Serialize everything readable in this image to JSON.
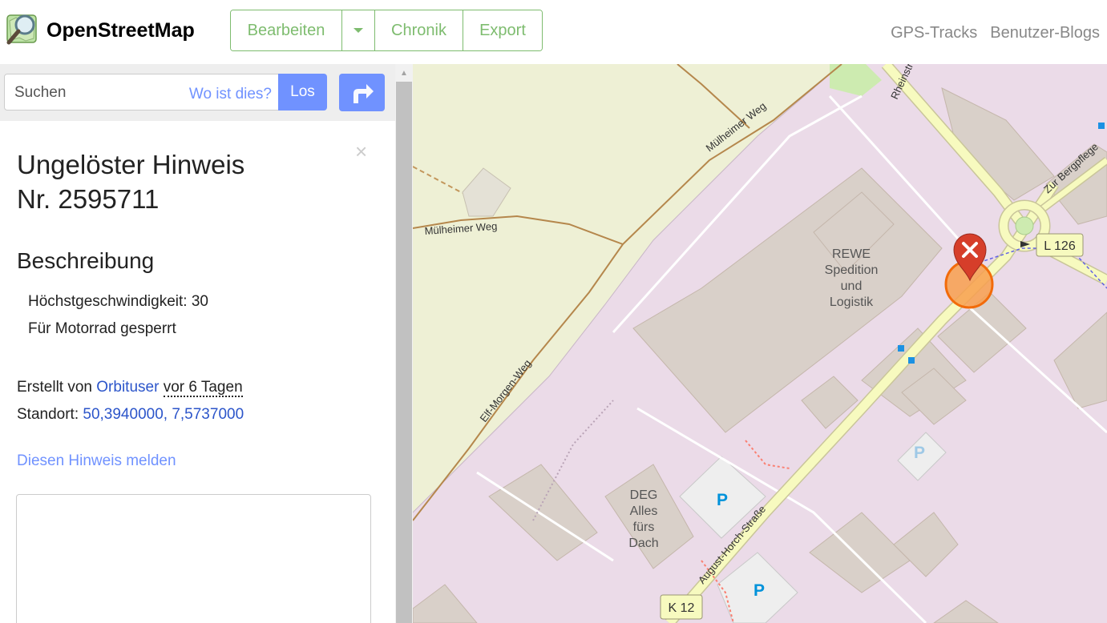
{
  "header": {
    "brand": "OpenStreetMap",
    "edit_label": "Bearbeiten",
    "history_label": "Chronik",
    "export_label": "Export",
    "gps_label": "GPS-Tracks",
    "blogs_label": "Benutzer-Blogs",
    "accent": "#7ebc6f"
  },
  "search": {
    "placeholder": "Suchen",
    "where_label": "Wo ist dies?",
    "go_label": "Los",
    "button_color": "#7092ff"
  },
  "note": {
    "title_line1": "Ungelöster Hinweis",
    "title_line2": "Nr. 2595711",
    "close": "×",
    "desc_heading": "Beschreibung",
    "desc_line1": "Höchstgeschwindigkeit: 30",
    "desc_line2": "Für Motorrad gesperrt",
    "created_prefix": "Erstellt von",
    "created_user": "Orbituser",
    "created_ago": "vor 6 Tagen",
    "location_prefix": "Standort:",
    "location_value": "50,3940000, 7,5737000",
    "report_label": "Diesen Hinweis melden"
  },
  "map": {
    "labels": {
      "muelheimer_weg_1": "Mülheimer Weg",
      "muelheimer_weg_2": "Mülheimer Weg",
      "elf_morgen_weg": "Elf-Morgen-Weg",
      "august_horch": "August-Horch-Straße",
      "zur_bergpflege": "Zur Bergpflege",
      "rheinstr": "Rheinstr",
      "rewe_1": "REWE",
      "rewe_2": "Spedition",
      "rewe_3": "und",
      "rewe_4": "Logistik",
      "deg_1": "DEG",
      "deg_2": "Alles",
      "deg_3": "fürs",
      "deg_4": "Dach",
      "l126": "L 126",
      "k12": "K 12",
      "parking": "P"
    },
    "colors": {
      "industrial": "#ebdbe8",
      "farmland": "#eef0d5",
      "building": "#d9d0c9",
      "road_major": "#f7fabf",
      "marker": "#d63e2a",
      "note_circle": "#f89f4e"
    }
  }
}
